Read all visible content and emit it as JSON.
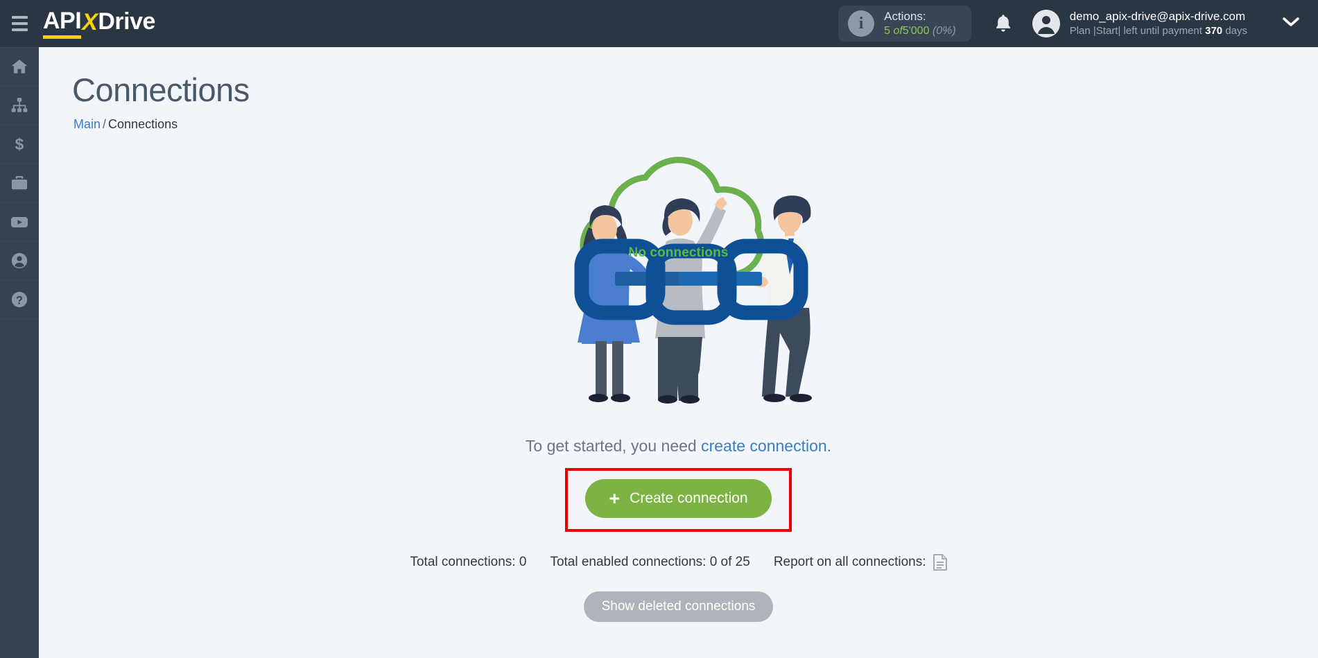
{
  "brand": {
    "logo_api": "API",
    "logo_x": "X",
    "logo_drive": "Drive",
    "accent_yellow": "#f7d308",
    "topbar_bg": "#2b3643",
    "sidebar_bg": "#364152",
    "content_bg": "#f2f5fa",
    "green": "#7cb342",
    "link_blue": "#3b7dc4",
    "highlight_red": "#ee0000"
  },
  "topbar": {
    "menu_icon": "hamburger-icon",
    "actions": {
      "icon": "info-icon",
      "label": "Actions:",
      "used": "5",
      "of": "of",
      "limit": "5'000",
      "percent": "(0%)"
    },
    "notifications_icon": "bell-icon",
    "account": {
      "avatar_icon": "user-avatar-icon",
      "email": "demo_apix-drive@apix-drive.com",
      "plan_prefix": "Plan |Start| left until payment",
      "plan_days": "370",
      "plan_suffix": "days",
      "chevron_icon": "chevron-down-icon"
    }
  },
  "sidebar": {
    "items": [
      {
        "name": "home",
        "icon": "home-icon"
      },
      {
        "name": "connections",
        "icon": "sitemap-icon"
      },
      {
        "name": "billing",
        "icon": "dollar-icon"
      },
      {
        "name": "business",
        "icon": "briefcase-icon"
      },
      {
        "name": "video",
        "icon": "video-play-icon"
      },
      {
        "name": "account",
        "icon": "user-circle-icon"
      },
      {
        "name": "help",
        "icon": "question-circle-icon"
      }
    ]
  },
  "page": {
    "title": "Connections",
    "breadcrumb": {
      "root": "Main",
      "separator": "/",
      "current": "Connections"
    },
    "illustration": {
      "cloud_label": "No connections",
      "alt": "three people holding chain links under a cloud"
    },
    "hint_prefix": "To get started, you need",
    "hint_link": "create connection",
    "hint_suffix": ".",
    "create_button": {
      "plus": "+",
      "label": "Create connection"
    },
    "stats": {
      "total_connections": "Total connections: 0",
      "total_enabled": "Total enabled connections: 0 of 25",
      "report_label": "Report on all connections:",
      "report_icon": "document-icon"
    },
    "show_deleted_button": "Show deleted connections"
  }
}
